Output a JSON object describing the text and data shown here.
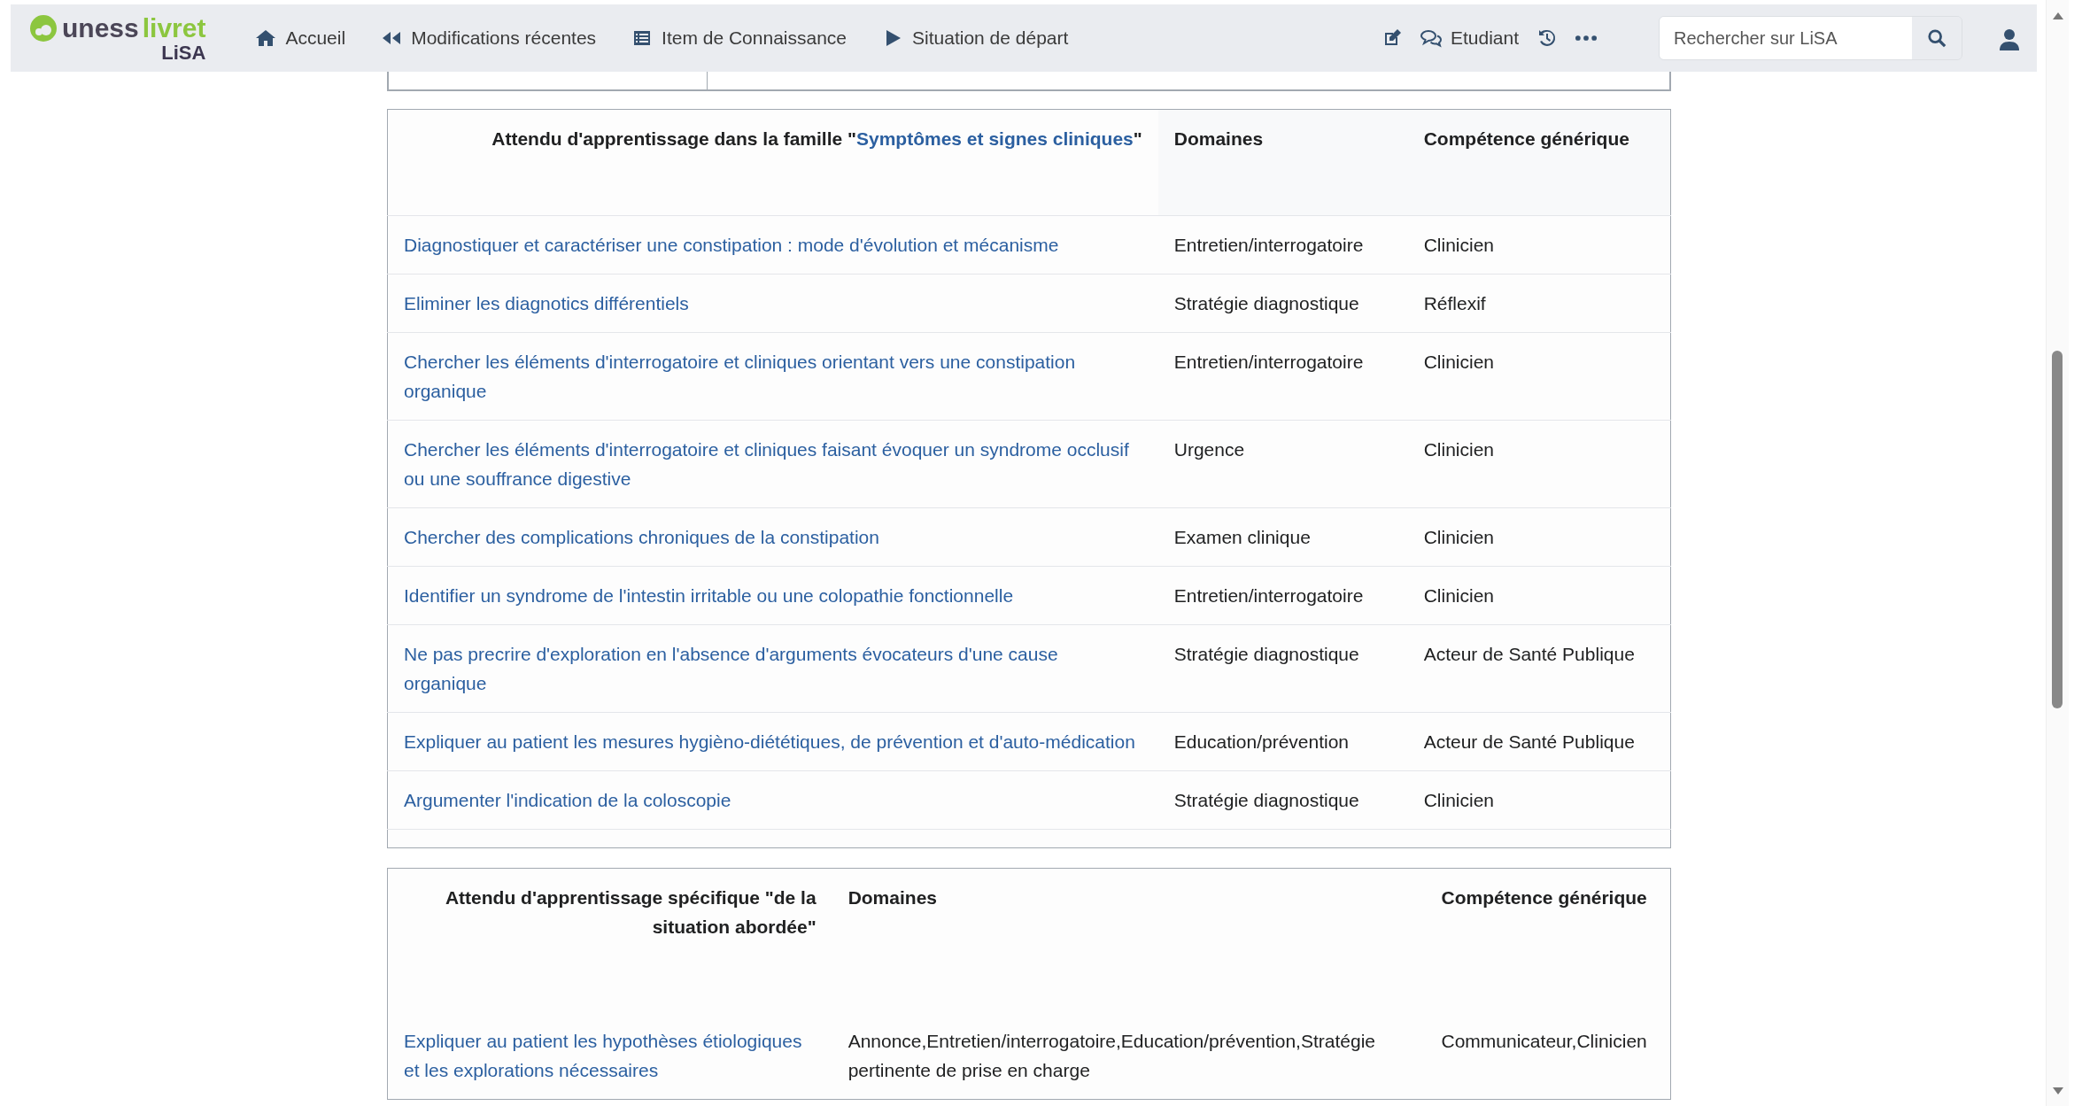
{
  "navbar": {
    "logo": {
      "name": "uness",
      "accent": "livret",
      "sub": "LiSA"
    },
    "links": [
      {
        "label": "Accueil"
      },
      {
        "label": "Modifications récentes"
      },
      {
        "label": "Item de Connaissance"
      },
      {
        "label": "Situation de départ"
      }
    ],
    "user_mode": {
      "label": "Etudiant"
    },
    "search": {
      "placeholder": "Rechercher sur LiSA"
    }
  },
  "family_table": {
    "title_before": "Attendu d'apprentissage dans la famille \"",
    "title_link": "Symptômes et signes cliniques",
    "title_after": "\"",
    "columns": [
      "Domaines",
      "Compétence générique"
    ],
    "rows": [
      {
        "attendu": "Diagnostiquer et caractériser une constipation : mode d'évolution et mécanisme",
        "domaine": "Entretien/interrogatoire",
        "competence": "Clinicien"
      },
      {
        "attendu": "Eliminer les diagnotics différentiels",
        "domaine": "Stratégie diagnostique",
        "competence": "Réflexif"
      },
      {
        "attendu": "Chercher les éléments d'interrogatoire et cliniques orientant vers une constipation organique",
        "domaine": "Entretien/interrogatoire",
        "competence": "Clinicien"
      },
      {
        "attendu": "Chercher les éléments d'interrogatoire et cliniques faisant évoquer un syndrome occlusif ou une souffrance digestive",
        "domaine": "Urgence",
        "competence": "Clinicien"
      },
      {
        "attendu": "Chercher des complications chroniques de la constipation",
        "domaine": "Examen clinique",
        "competence": "Clinicien"
      },
      {
        "attendu": "Identifier un syndrome de l'intestin irritable ou une colopathie fonctionnelle",
        "domaine": "Entretien/interrogatoire",
        "competence": "Clinicien"
      },
      {
        "attendu": "Ne pas precrire d'exploration en l'absence d'arguments évocateurs d'une cause organique",
        "domaine": "Stratégie diagnostique",
        "competence": "Acteur de Santé Publique"
      },
      {
        "attendu": "Expliquer au patient les mesures hygièno-diététiques, de prévention et d'auto-médication",
        "domaine": "Education/prévention",
        "competence": "Acteur de Santé Publique"
      },
      {
        "attendu": "Argumenter l'indication de la coloscopie",
        "domaine": "Stratégie diagnostique",
        "competence": "Clinicien"
      }
    ]
  },
  "specific_table": {
    "title": "Attendu d'apprentissage spécifique \"de la situation abordée\"",
    "columns": [
      "Domaines",
      "Compétence générique"
    ],
    "rows": [
      {
        "attendu": "Expliquer au patient les hypothèses étiologiques et les explorations nécessaires",
        "domaine": "Annonce,Entretien/interrogatoire,Education/prévention,Stratégie pertinente de prise en charge",
        "competence": "Communicateur,Clinicien"
      }
    ]
  }
}
